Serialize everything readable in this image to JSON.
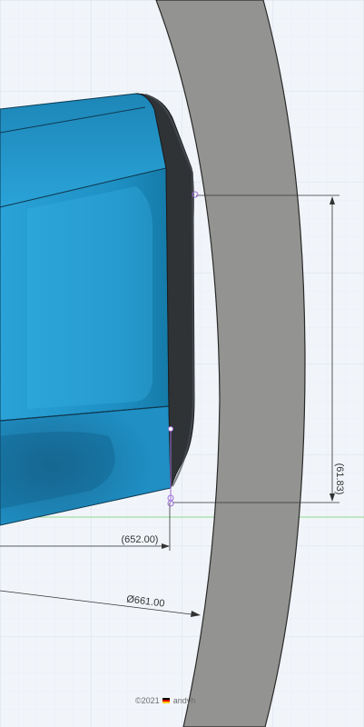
{
  "viewport": {
    "background": "#f3f6fa",
    "grid_color": "#d4dde8"
  },
  "colors": {
    "ring_fill": "#939391",
    "ring_stroke": "#2a2a2a",
    "body_blue": "#1f8fc4",
    "body_dark": "#2f3336",
    "dimension_line": "#333333",
    "sketch_point": "#9b6fd6",
    "axis_green": "#7ed57e"
  },
  "dimensions": {
    "vertical_gap": "(61.83)",
    "horizontal_offset": "(652.00)",
    "diameter": "Ø661.00"
  },
  "watermark": {
    "year": "©2021",
    "flag_icon": "german-flag-icon",
    "author": "andyh"
  }
}
